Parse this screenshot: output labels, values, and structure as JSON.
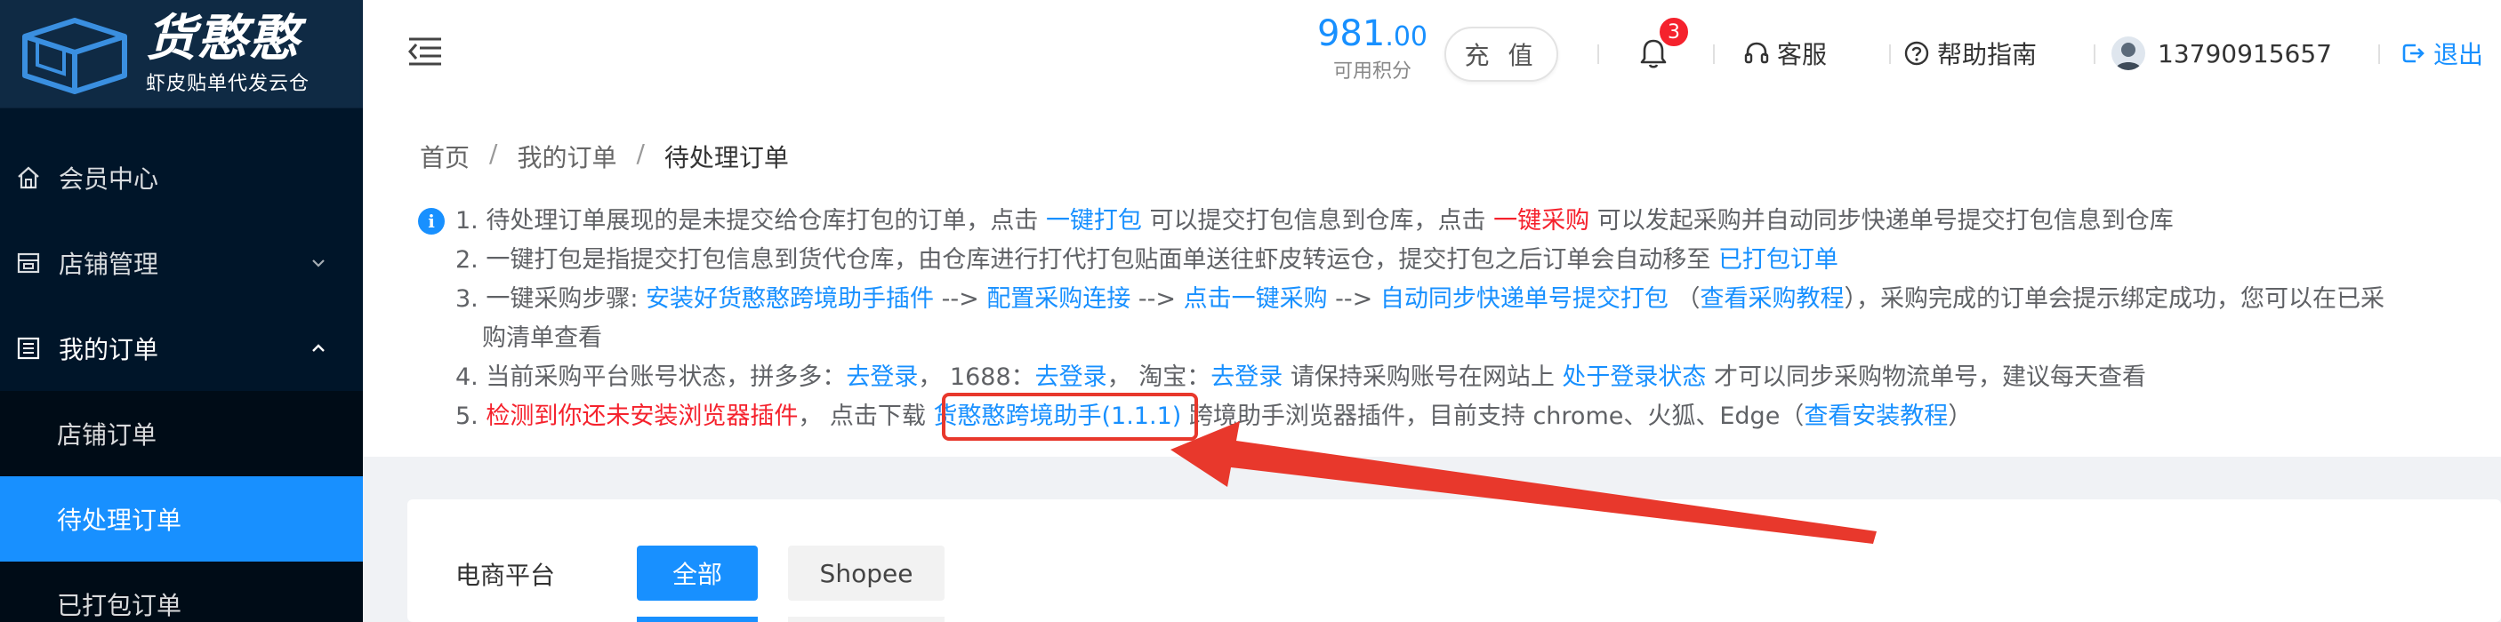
{
  "brand": {
    "title": "货憨憨",
    "subtitle": "虾皮贴单代发云仓"
  },
  "sidebar": {
    "items": [
      {
        "label": "会员中心",
        "icon": "home-icon"
      },
      {
        "label": "店铺管理",
        "icon": "shop-icon"
      },
      {
        "label": "我的订单",
        "icon": "order-list-icon"
      }
    ],
    "submenu": [
      {
        "label": "店铺订单"
      },
      {
        "label": "待处理订单"
      },
      {
        "label": "已打包订单"
      }
    ]
  },
  "header": {
    "points_int": "981",
    "points_dec": ".00",
    "points_label": "可用积分",
    "recharge_label": "充 值",
    "notification_count": "3",
    "service_label": "客服",
    "help_label": "帮助指南",
    "account": "13790915657",
    "logout_label": "退出"
  },
  "breadcrumb": [
    "首页",
    "我的订单",
    "待处理订单"
  ],
  "notice": {
    "line1": {
      "a": "1. 待处理订单展现的是未提交给仓库打包的订单，点击 ",
      "b": "一键打包",
      "c": " 可以提交打包信息到仓库，点击 ",
      "d": "一键采购",
      "e": " 可以发起采购并自动同步快递单号提交打包信息到仓库"
    },
    "line2": {
      "a": "2. 一键打包是指提交打包信息到货代仓库，由仓库进行打代打包贴面单送往虾皮转运仓，提交打包之后订单会自动移至 ",
      "b": "已打包订单"
    },
    "line3": {
      "a": "3. 一键采购步骤: ",
      "b": "安装好货憨憨跨境助手插件",
      "c": " --> ",
      "d": "配置采购连接",
      "e": " --> ",
      "f": "点击一键采购",
      "g": " --> ",
      "h": "自动同步快递单号提交打包",
      "i": " （",
      "j": "查看采购教程",
      "k": "），采购完成的订单会提示绑定成功，您可以在已采",
      "l": "购清单查看"
    },
    "line4": {
      "a": "4. 当前采购平台账号状态，拼多多：",
      "b": "去登录",
      "c": "，  1688：",
      "d": "去登录",
      "e": "，  淘宝：",
      "f": "去登录",
      "g": " 请保持采购账号在网站上 ",
      "h": "处于登录状态",
      "i": " 才可以同步采购物流单号，建议每天查看"
    },
    "line5": {
      "a": "5. ",
      "b": "检测到你还未安装浏览器插件",
      "c": "，  点击下载 ",
      "d": "货憨憨跨境助手(1.1.1)",
      "e": " 跨境助手浏览器插件，目前支持 chrome、火狐、Edge（",
      "f": "查看安装教程",
      "g": "）"
    }
  },
  "filter": {
    "label": "电商平台",
    "options": [
      "全部",
      "Shopee"
    ]
  },
  "colors": {
    "accent": "#1890ff",
    "sidebar_bg": "#001529",
    "warning_red": "#f5222d",
    "annotation_red": "#e8382c"
  }
}
